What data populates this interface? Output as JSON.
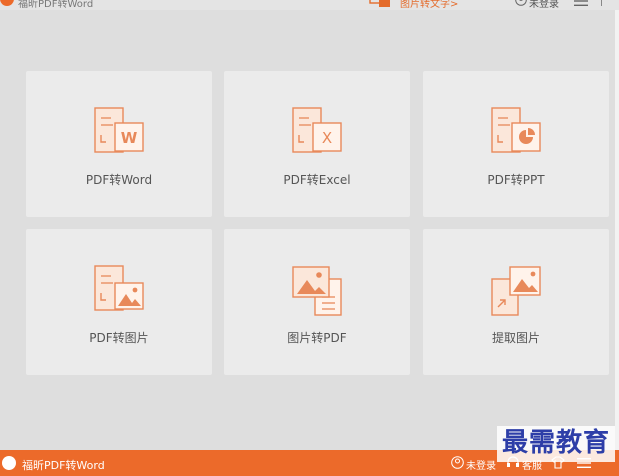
{
  "app": {
    "title": "福昕PDF转Word",
    "brand_color": "#ec6a2a"
  },
  "header": {
    "image_to_text_label": "图片转文字>",
    "login_label": "未登录",
    "icons": [
      "app-logo-icon",
      "image-to-text-icon",
      "user-icon",
      "menu-icon"
    ]
  },
  "tools": [
    {
      "label": "PDF转Word",
      "icon": "pdf-to-word-icon"
    },
    {
      "label": "PDF转Excel",
      "icon": "pdf-to-excel-icon"
    },
    {
      "label": "PDF转PPT",
      "icon": "pdf-to-ppt-icon"
    },
    {
      "label": "PDF转图片",
      "icon": "pdf-to-image-icon"
    },
    {
      "label": "图片转PDF",
      "icon": "image-to-pdf-icon"
    },
    {
      "label": "提取图片",
      "icon": "extract-image-icon"
    }
  ],
  "footer": {
    "title": "福昕PDF转Word",
    "login_label": "未登录",
    "service_label": "客服",
    "icons": [
      "app-logo-icon",
      "user-icon",
      "customer-service-icon",
      "skin-icon",
      "menu-icon"
    ]
  },
  "watermark": {
    "text": "最需教育",
    "color": "#2d3ea8"
  }
}
